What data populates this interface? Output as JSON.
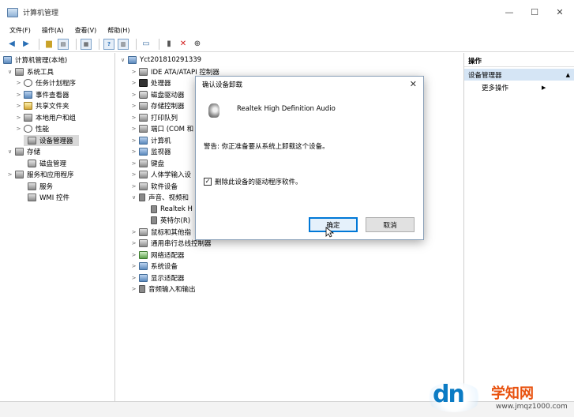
{
  "window": {
    "title": "计算机管理",
    "min_glyph": "—",
    "max_glyph": "☐",
    "close_glyph": "✕"
  },
  "menu": [
    "文件(F)",
    "操作(A)",
    "查看(V)",
    "帮助(H)"
  ],
  "toolbar_icons": [
    "back-arrow-icon",
    "forward-arrow-icon",
    "up-folder-icon",
    "show-hide-tree-icon",
    "properties-icon",
    "help-icon",
    "view-icon",
    "monitor-icon",
    "update-driver-icon",
    "uninstall-x-icon",
    "scan-download-icon"
  ],
  "left_tree": [
    {
      "label": "计算机管理(本地)",
      "indent": 0,
      "icon": "computer-icon"
    },
    {
      "label": "系统工具",
      "indent": 1,
      "icon": "tools-icon",
      "expanded": true
    },
    {
      "label": "任务计划程序",
      "indent": 2,
      "icon": "clock-icon"
    },
    {
      "label": "事件查看器",
      "indent": 2,
      "icon": "event-viewer-icon"
    },
    {
      "label": "共享文件夹",
      "indent": 2,
      "icon": "shared-folder-icon"
    },
    {
      "label": "本地用户和组",
      "indent": 2,
      "icon": "users-icon"
    },
    {
      "label": "性能",
      "indent": 2,
      "icon": "performance-icon"
    },
    {
      "label": "设备管理器",
      "indent": 2,
      "icon": "device-manager-icon",
      "selected": true
    },
    {
      "label": "存储",
      "indent": 1,
      "icon": "storage-icon",
      "expanded": true
    },
    {
      "label": "磁盘管理",
      "indent": 2,
      "icon": "disk-icon"
    },
    {
      "label": "服务和应用程序",
      "indent": 1,
      "icon": "services-apps-icon"
    },
    {
      "label": "服务",
      "indent": 2,
      "icon": "services-icon"
    },
    {
      "label": "WMI 控件",
      "indent": 2,
      "icon": "wmi-icon"
    }
  ],
  "device_tree": {
    "root": "Yct201810291339",
    "items": [
      {
        "label": "IDE ATA/ATAPI 控制器",
        "icon": "ide-controller-icon"
      },
      {
        "label": "处理器",
        "icon": "processor-icon"
      },
      {
        "label": "磁盘驱动器",
        "icon": "disk-drive-icon"
      },
      {
        "label": "存储控制器",
        "icon": "storage-controller-icon"
      },
      {
        "label": "打印队列",
        "icon": "print-queue-icon"
      },
      {
        "label": "端口 (COM 和",
        "icon": "port-icon"
      },
      {
        "label": "计算机",
        "icon": "computer-icon"
      },
      {
        "label": "监视器",
        "icon": "monitor-icon"
      },
      {
        "label": "键盘",
        "icon": "keyboard-icon"
      },
      {
        "label": "人体学输入设",
        "icon": "hid-icon"
      },
      {
        "label": "软件设备",
        "icon": "software-device-icon"
      },
      {
        "label": "声音、视频和",
        "icon": "sound-icon",
        "expanded": true
      },
      {
        "label": "Realtek H",
        "icon": "speaker-icon",
        "child": true
      },
      {
        "label": "英特尔(R)",
        "icon": "speaker-icon",
        "child": true
      },
      {
        "label": "鼠标和其他指",
        "icon": "mouse-icon"
      },
      {
        "label": "通用串行总线控制器",
        "icon": "usb-icon"
      },
      {
        "label": "网络适配器",
        "icon": "network-adapter-icon"
      },
      {
        "label": "系统设备",
        "icon": "system-device-icon"
      },
      {
        "label": "显示适配器",
        "icon": "display-adapter-icon"
      },
      {
        "label": "音频输入和输出",
        "icon": "audio-io-icon"
      }
    ]
  },
  "actions": {
    "header": "操作",
    "selected": "设备管理器",
    "more": "更多操作"
  },
  "dialog": {
    "title": "确认设备卸载",
    "device_name": "Realtek High Definition Audio",
    "warning": "警告: 你正准备要从系统上卸载这个设备。",
    "checkbox_label": "删除此设备的驱动程序软件。",
    "checkbox_checked": true,
    "ok_label": "确定",
    "cancel_label": "取消"
  },
  "watermark": {
    "logo": "dn",
    "site_name": "学知网",
    "url": "www.jmqz1000.com"
  }
}
